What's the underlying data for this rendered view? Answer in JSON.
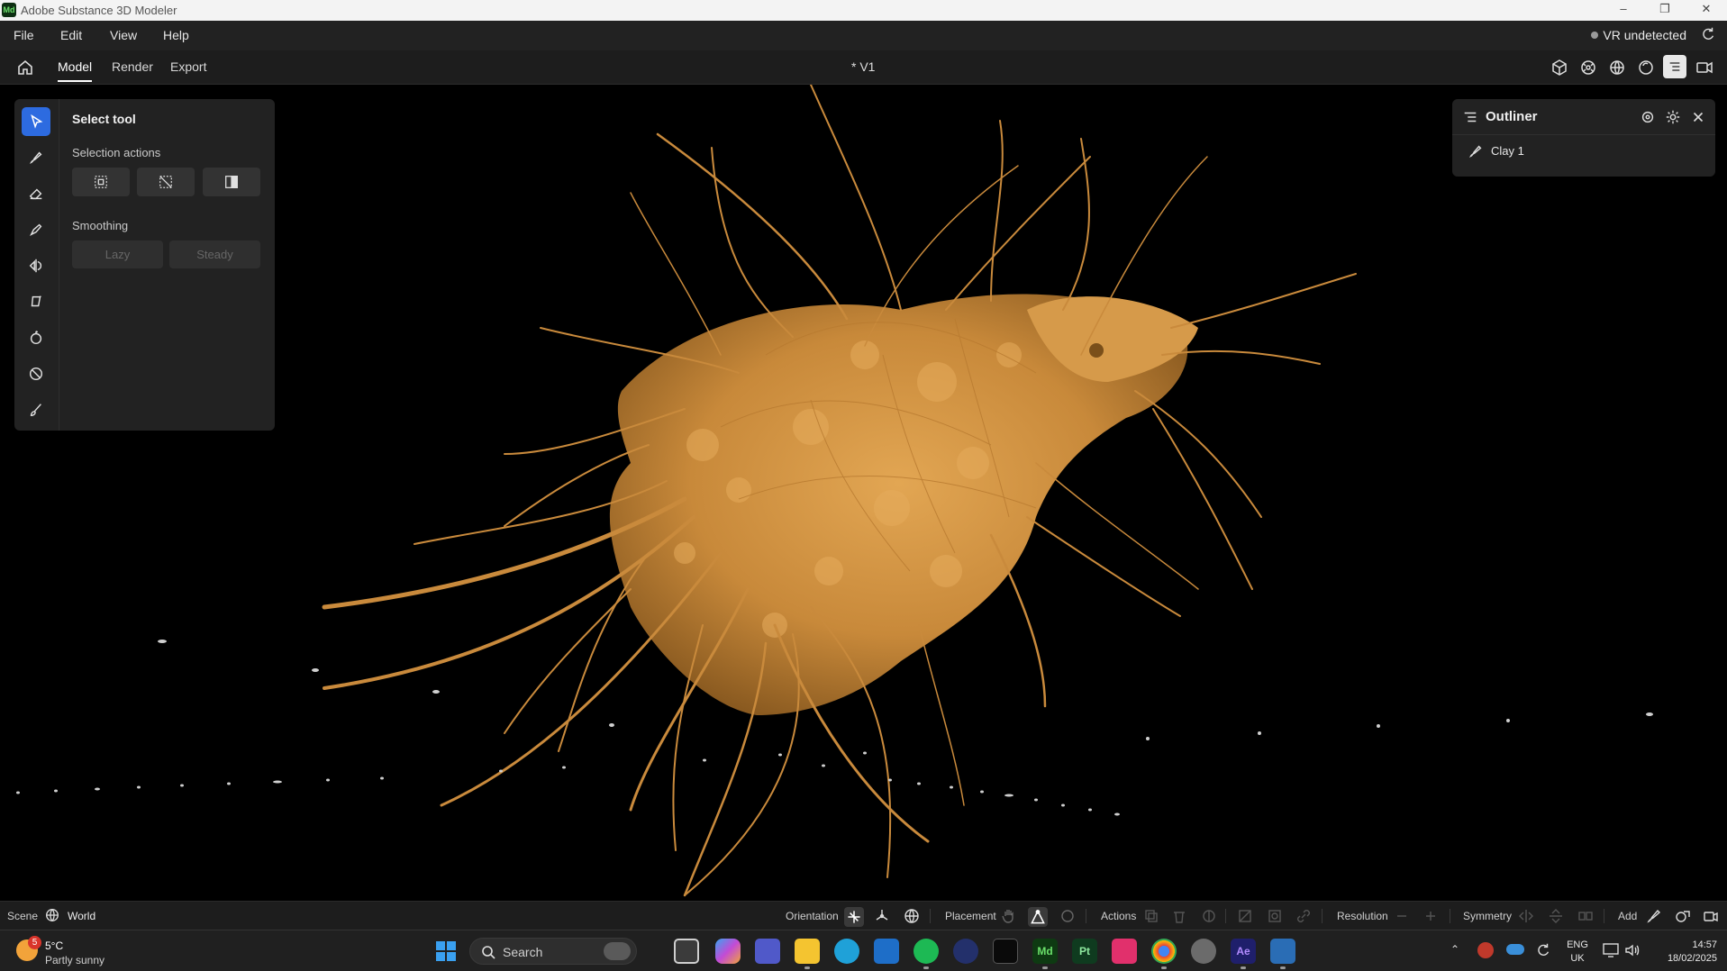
{
  "app": {
    "window_title": "Adobe Substance 3D Modeler",
    "logo_text": "Md",
    "window_controls": [
      "minimize-icon",
      "restore-icon",
      "close-icon"
    ]
  },
  "menubar": {
    "items": [
      "File",
      "Edit",
      "View",
      "Help"
    ],
    "vr_status": "VR undetected"
  },
  "tabs": {
    "items": [
      "Model",
      "Render",
      "Export"
    ],
    "active": "Model",
    "document_title": "* V1"
  },
  "tool_panel": {
    "title": "Select tool",
    "selection_actions_label": "Selection actions",
    "smoothing_label": "Smoothing",
    "smoothing_options": [
      "Lazy",
      "Steady"
    ],
    "tools": [
      "select-tool-icon",
      "clay-brush-icon",
      "eraser-icon",
      "smooth-brush-icon",
      "symmetry-tool-icon",
      "lasso-icon",
      "move-tool-icon",
      "stamp-tool-icon",
      "paint-brush-icon"
    ]
  },
  "outliner": {
    "title": "Outliner",
    "items": [
      {
        "label": "Clay 1",
        "icon": "clay-layer-icon"
      }
    ]
  },
  "bottom_bar": {
    "scene_label": "Scene",
    "world_label": "World",
    "orientation_label": "Orientation",
    "placement_label": "Placement",
    "actions_label": "Actions",
    "resolution_label": "Resolution",
    "symmetry_label": "Symmetry",
    "add_label": "Add"
  },
  "taskbar": {
    "weather_badge": "5",
    "weather_temp": "5°C",
    "weather_desc": "Partly sunny",
    "search_placeholder": "Search",
    "language_top": "ENG",
    "language_bottom": "UK",
    "time": "14:57",
    "date": "18/02/2025"
  },
  "colors": {
    "accent": "#2d6be0",
    "model": "#c8893a",
    "panel": "#222222"
  }
}
